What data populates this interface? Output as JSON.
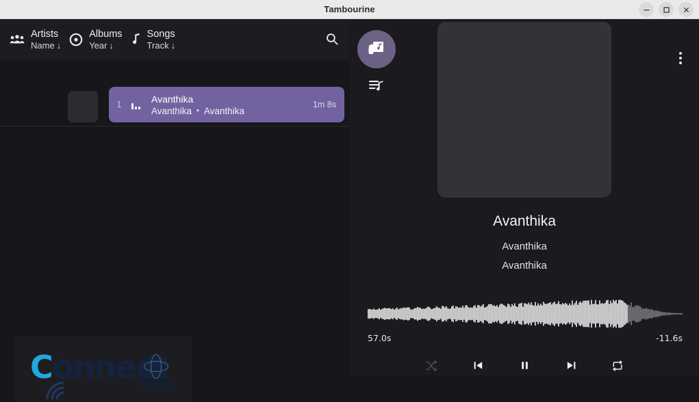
{
  "window": {
    "title": "Tambourine",
    "buttons": [
      {
        "name": "minimize",
        "glyph": "minimize-icon"
      },
      {
        "name": "maximize",
        "glyph": "maximize-icon"
      },
      {
        "name": "close",
        "glyph": "close-icon"
      }
    ]
  },
  "library_nav": [
    {
      "label": "Artists",
      "sort": "Name",
      "sort_direction": "↓",
      "icon": "artists-icon"
    },
    {
      "label": "Albums",
      "sort": "Year",
      "sort_direction": "↓",
      "icon": "albums-disc-icon"
    },
    {
      "label": "Songs",
      "sort": "Track",
      "sort_direction": "↓",
      "icon": "music-note-icon"
    }
  ],
  "search": {
    "icon": "search-icon",
    "placeholder": "Search"
  },
  "track_list": {
    "rows": [
      {
        "number": "1",
        "status_icon": "equalizer-playing-icon",
        "title": "Avanthika",
        "artist": "Avanthika",
        "separator": "•",
        "album": "Avanthika",
        "duration": "1m 8s",
        "selected": true
      }
    ]
  },
  "watermark": {
    "letter": "C",
    "word": "onnect",
    "tld": "com",
    "globe_icon": "globe-icon",
    "colors": {
      "cyan": "#21a8dd",
      "dark": "#14243f"
    }
  },
  "side_rail": [
    {
      "name": "library-albums",
      "icon": "album-stack-icon",
      "active": true
    },
    {
      "name": "queue",
      "icon": "playlist-queue-icon",
      "active": false
    }
  ],
  "overflow_menu": {
    "icon": "more-vertical-icon"
  },
  "now_playing": {
    "artwork": "album-art-placeholder",
    "title": "Avanthika",
    "artist": "Avanthika",
    "album": "Avanthika",
    "elapsed": "57.0s",
    "remaining": "-11.6s",
    "progress_percent": 83
  },
  "transport": [
    {
      "name": "shuffle",
      "icon": "shuffle-icon",
      "state": "disabled"
    },
    {
      "name": "previous",
      "icon": "skip-previous-icon",
      "state": "enabled"
    },
    {
      "name": "play-pause",
      "icon": "pause-icon",
      "state": "enabled"
    },
    {
      "name": "next",
      "icon": "skip-next-icon",
      "state": "enabled"
    },
    {
      "name": "repeat",
      "icon": "repeat-icon",
      "state": "enabled"
    }
  ],
  "theme": {
    "window_chrome": "#eaeaea",
    "app_background": "#17171b",
    "panel_background": "#1a1a1f",
    "header_background": "#1c1c21",
    "accent_selected": "#7263a0",
    "rail_active": "#6c6285",
    "art_placeholder": "#323238",
    "wave_played": "#d6d6d6",
    "wave_unplayed": "#6f6f74"
  }
}
